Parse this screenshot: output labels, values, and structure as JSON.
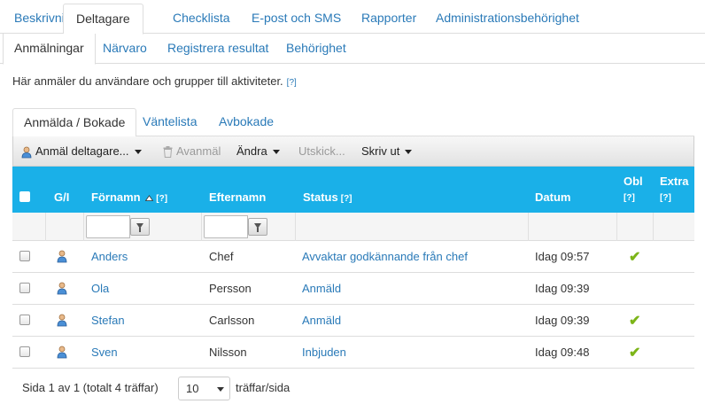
{
  "main_tabs": [
    "Beskrivning",
    "Deltagare",
    "Checklista",
    "E-post och SMS",
    "Rapporter",
    "Administrationsbehörighet"
  ],
  "sub_tabs": [
    "Anmälningar",
    "Närvaro",
    "Registrera resultat",
    "Behörighet"
  ],
  "description": {
    "text": "Här anmäler du användare och grupper till aktiviteter.",
    "help": "[?]"
  },
  "list_tabs": [
    "Anmälda / Bokade",
    "Väntelista",
    "Avbokade"
  ],
  "toolbar": {
    "register": "Anmäl deltagare...",
    "unregister": "Avanmäl",
    "change": "Ändra",
    "send": "Utskick...",
    "print": "Skriv ut"
  },
  "columns": {
    "type": "G/I",
    "firstname": "Förnamn",
    "lastname": "Efternamn",
    "status": "Status",
    "date": "Datum",
    "obl": "Obl",
    "extra": "Extra",
    "help": "[?]"
  },
  "rows": [
    {
      "firstname": "Anders",
      "lastname": "Chef",
      "status": "Avvaktar godkännande från chef",
      "date": "Idag 09:57",
      "obl": true
    },
    {
      "firstname": "Ola",
      "lastname": "Persson",
      "status": "Anmäld",
      "date": "Idag 09:39",
      "obl": false
    },
    {
      "firstname": "Stefan",
      "lastname": "Carlsson",
      "status": "Anmäld",
      "date": "Idag 09:39",
      "obl": true
    },
    {
      "firstname": "Sven",
      "lastname": "Nilsson",
      "status": "Inbjuden",
      "date": "Idag 09:48",
      "obl": true
    }
  ],
  "pager": {
    "info": "Sida 1 av 1 (totalt 4 träffar)",
    "page_size": "10",
    "per_page_label": "träffar/sida"
  },
  "colors": {
    "header_blue": "#1ab0e8",
    "link_blue": "#2a7ab8",
    "check_green": "#7cb518"
  }
}
